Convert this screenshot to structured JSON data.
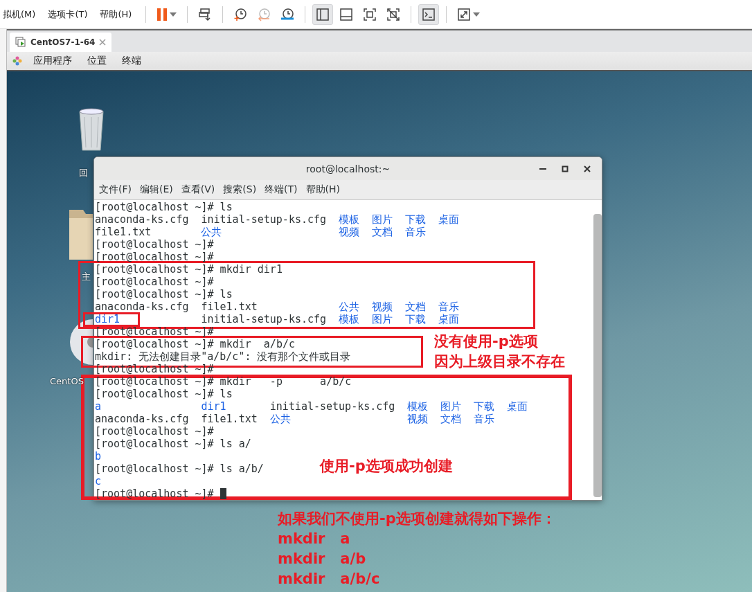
{
  "menu": [
    "拟机(M)",
    "选项卡(T)",
    "帮助(H)"
  ],
  "toolbar": [
    {
      "kind": "separator"
    },
    {
      "kind": "pause",
      "pressed": false
    },
    {
      "kind": "separator"
    },
    {
      "kind": "send-keys",
      "pressed": false
    },
    {
      "kind": "separator"
    },
    {
      "kind": "snapshot-take",
      "pressed": false
    },
    {
      "kind": "snapshot-revert",
      "pressed": false
    },
    {
      "kind": "snapshot-manager",
      "pressed": false
    },
    {
      "kind": "separator"
    },
    {
      "kind": "view-sidebar",
      "pressed": true
    },
    {
      "kind": "view-bottom",
      "pressed": false
    },
    {
      "kind": "view-fullscreen",
      "pressed": false
    },
    {
      "kind": "view-unity",
      "pressed": false
    },
    {
      "kind": "separator"
    },
    {
      "kind": "console",
      "pressed": true
    },
    {
      "kind": "separator"
    },
    {
      "kind": "stretch",
      "pressed": false
    }
  ],
  "tabs": [
    {
      "label": "CentOS7-1-64",
      "selected": true
    }
  ],
  "gnome_bar": {
    "items": [
      "应用程序",
      "位置",
      "终端"
    ]
  },
  "desktop_icons": [
    {
      "kind": "trash",
      "label": "回"
    },
    {
      "kind": "home-folder",
      "label": "主"
    },
    {
      "kind": "disc",
      "label": "CentOS"
    }
  ],
  "terminal": {
    "title": "root@localhost:~",
    "menu": [
      "文件(F)",
      "编辑(E)",
      "查看(V)",
      "搜索(S)",
      "终端(T)",
      "帮助(H)"
    ],
    "lines": [
      {
        "kind": "text",
        "text": "[root@localhost ~]# ls",
        "cursor": false
      },
      {
        "kind": "listing",
        "rows": [
          [
            {
              "text": "anaconda-ks.cfg",
              "dir": false
            },
            {
              "text": "initial-setup-ks.cfg",
              "dir": false
            },
            {
              "text": "模板",
              "dir": true
            },
            {
              "text": "图片",
              "dir": true
            },
            {
              "text": "下载",
              "dir": true
            },
            {
              "text": "桌面",
              "dir": true
            }
          ],
          [
            {
              "text": "file1.txt",
              "dir": false
            },
            {
              "text": "公共",
              "dir": true
            },
            {
              "text": "视频",
              "dir": true
            },
            {
              "text": "文档",
              "dir": true
            },
            {
              "text": "音乐",
              "dir": true
            }
          ]
        ]
      },
      {
        "kind": "text",
        "text": "[root@localhost ~]#",
        "cursor": false
      },
      {
        "kind": "text",
        "text": "[root@localhost ~]#",
        "cursor": false
      },
      {
        "kind": "text",
        "text": "[root@localhost ~]# mkdir dir1",
        "cursor": false
      },
      {
        "kind": "text",
        "text": "[root@localhost ~]#",
        "cursor": false
      },
      {
        "kind": "text",
        "text": "[root@localhost ~]# ls",
        "cursor": false
      },
      {
        "kind": "listing",
        "rows": [
          [
            {
              "text": "anaconda-ks.cfg",
              "dir": false
            },
            {
              "text": "file1.txt",
              "dir": false
            },
            {
              "text": "公共",
              "dir": true
            },
            {
              "text": "视频",
              "dir": true
            },
            {
              "text": "文档",
              "dir": true
            },
            {
              "text": "音乐",
              "dir": true
            }
          ],
          [
            {
              "text": "dir1",
              "dir": true
            },
            {
              "text": "initial-setup-ks.cfg",
              "dir": false
            },
            {
              "text": "模板",
              "dir": true
            },
            {
              "text": "图片",
              "dir": true
            },
            {
              "text": "下载",
              "dir": true
            },
            {
              "text": "桌面",
              "dir": true
            }
          ]
        ]
      },
      {
        "kind": "text",
        "text": "[root@localhost ~]#",
        "cursor": false
      },
      {
        "kind": "text",
        "text": "[root@localhost ~]# mkdir  a/b/c",
        "cursor": false
      },
      {
        "kind": "text",
        "text": "mkdir: 无法创建目录\"a/b/c\": 没有那个文件或目录",
        "cursor": false
      },
      {
        "kind": "text",
        "text": "[root@localhost ~]#",
        "cursor": false
      },
      {
        "kind": "text",
        "text": "[root@localhost ~]# mkdir   -p      a/b/c",
        "cursor": false
      },
      {
        "kind": "text",
        "text": "[root@localhost ~]# ls",
        "cursor": false
      },
      {
        "kind": "listing",
        "rows": [
          [
            {
              "text": "a",
              "dir": true
            },
            {
              "text": "dir1",
              "dir": true
            },
            {
              "text": "initial-setup-ks.cfg",
              "dir": false
            },
            {
              "text": "模板",
              "dir": true
            },
            {
              "text": "图片",
              "dir": true
            },
            {
              "text": "下载",
              "dir": true
            },
            {
              "text": "桌面",
              "dir": true
            }
          ],
          [
            {
              "text": "anaconda-ks.cfg",
              "dir": false
            },
            {
              "text": "file1.txt",
              "dir": false
            },
            {
              "text": "公共",
              "dir": true
            },
            {
              "text": "视频",
              "dir": true
            },
            {
              "text": "文档",
              "dir": true
            },
            {
              "text": "音乐",
              "dir": true
            }
          ]
        ]
      },
      {
        "kind": "text",
        "text": "[root@localhost ~]#",
        "cursor": false
      },
      {
        "kind": "text",
        "text": "[root@localhost ~]# ls a/",
        "cursor": false
      },
      {
        "kind": "dir",
        "text": "b",
        "cursor": false
      },
      {
        "kind": "text",
        "text": "[root@localhost ~]# ls a/b/",
        "cursor": false
      },
      {
        "kind": "dir",
        "text": "c",
        "cursor": false
      },
      {
        "kind": "text",
        "text": "[root@localhost ~]# ",
        "cursor": true
      }
    ]
  },
  "notes": [
    {
      "lines": [
        "没有使用-p选项",
        "因为上级目录不存在"
      ]
    },
    {
      "lines": [
        "使用-p选项成功创建"
      ]
    },
    {
      "lines": [
        "如果我们不使用-p选项创建就得如下操作：",
        "mkdir   a",
        "mkdir   a/b",
        "mkdir   a/b/c"
      ]
    }
  ]
}
